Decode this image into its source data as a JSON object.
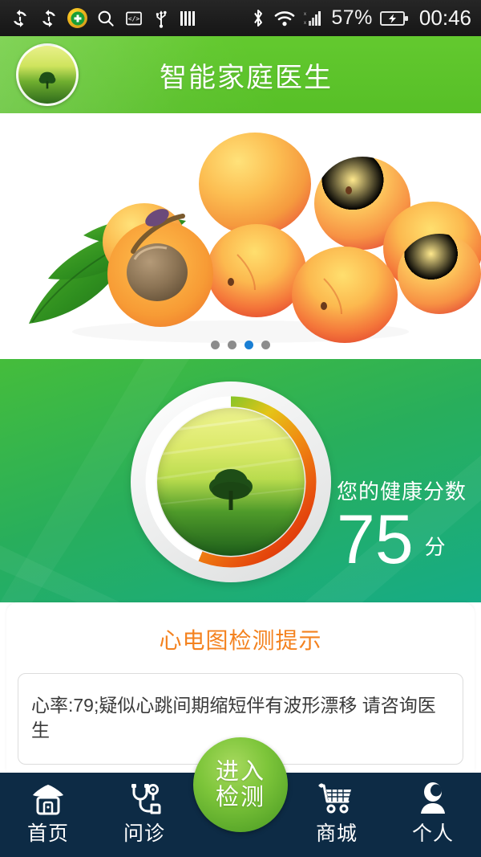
{
  "statusbar": {
    "icons_left": [
      "sync-icon",
      "sync-icon",
      "green-plus-circle-icon",
      "search-icon",
      "code-brackets-icon",
      "usb-icon",
      "bars-icon"
    ],
    "icons_right": [
      "bluetooth-icon",
      "wifi-icon",
      "signal-bars-icon"
    ],
    "battery_percent": "57%",
    "battery_state": "charging",
    "clock": "00:46"
  },
  "header": {
    "title": "智能家庭医生",
    "avatar": "tree-landscape-avatar"
  },
  "banner": {
    "alt": "apricots-with-leaves",
    "dots_total": 4,
    "dots_active_index": 2
  },
  "health": {
    "score_label": "您的健康分数",
    "score_value": "75",
    "score_unit": "分",
    "gauge": {
      "value": 75,
      "max": 100,
      "arc_colors": [
        "#d81e06",
        "#e8540f",
        "#f08c12",
        "#e8c31a",
        "#8bc828",
        "#2cb34a"
      ]
    }
  },
  "ecg": {
    "title": "心电图检测提示",
    "title_color": "#f4821f",
    "message": "心率:79;疑似心跳间期缩短伴有波形漂移 请咨询医生"
  },
  "nav": {
    "items": [
      {
        "label": "首页",
        "icon": "home-icon"
      },
      {
        "label": "问诊",
        "icon": "stethoscope-icon"
      },
      {
        "label": "商城",
        "icon": "shopping-cart-icon"
      },
      {
        "label": "个人",
        "icon": "person-icon"
      }
    ],
    "center": {
      "line1": "进入",
      "line2": "检测"
    }
  },
  "colors": {
    "header_green": "#5cc42c",
    "health_green": "#2cae58",
    "nav_navy": "#0d2b45",
    "accent_orange": "#f4821f",
    "dot_active": "#1a7fd4"
  }
}
